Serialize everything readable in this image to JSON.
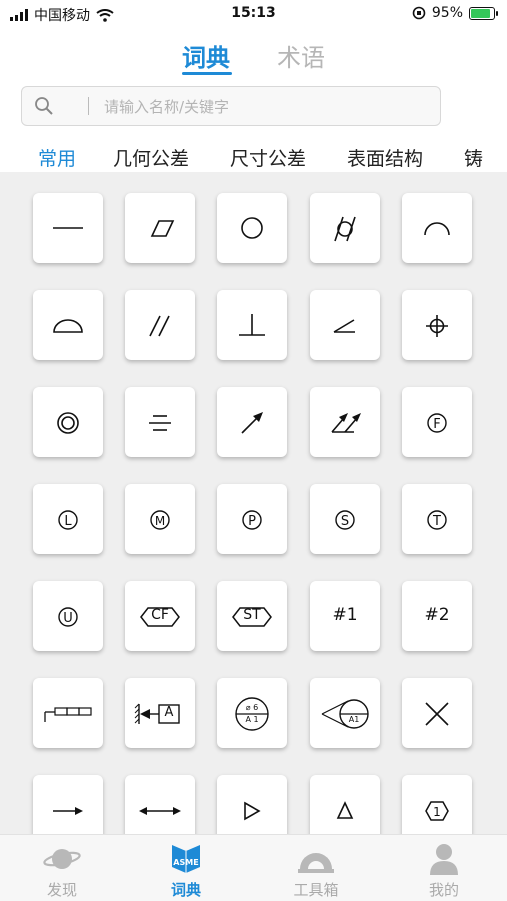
{
  "status_bar": {
    "carrier": "中国移动",
    "time": "15:13",
    "battery": "95%"
  },
  "top_tabs": [
    {
      "label": "词典"
    },
    {
      "label": "术语"
    }
  ],
  "search": {
    "placeholder": "请输入名称/关键字",
    "value": ""
  },
  "categories": [
    {
      "label": "常用"
    },
    {
      "label": "几何公差"
    },
    {
      "label": "尺寸公差"
    },
    {
      "label": "表面结构"
    },
    {
      "label": "铸"
    }
  ],
  "symbols": {
    "cf": "CF",
    "st": "ST",
    "hash1": "#1",
    "hash2": "#2",
    "datum_a": "A",
    "dia_top": "⌀ 6",
    "dia_bottom": "A 1",
    "datum_a1": "A1"
  },
  "bottom_nav": [
    {
      "label": "发现"
    },
    {
      "label": "词典"
    },
    {
      "label": "工具箱"
    },
    {
      "label": "我的"
    }
  ],
  "colors": {
    "accent": "#1e8ad6",
    "inactive": "#aaaaaa"
  }
}
